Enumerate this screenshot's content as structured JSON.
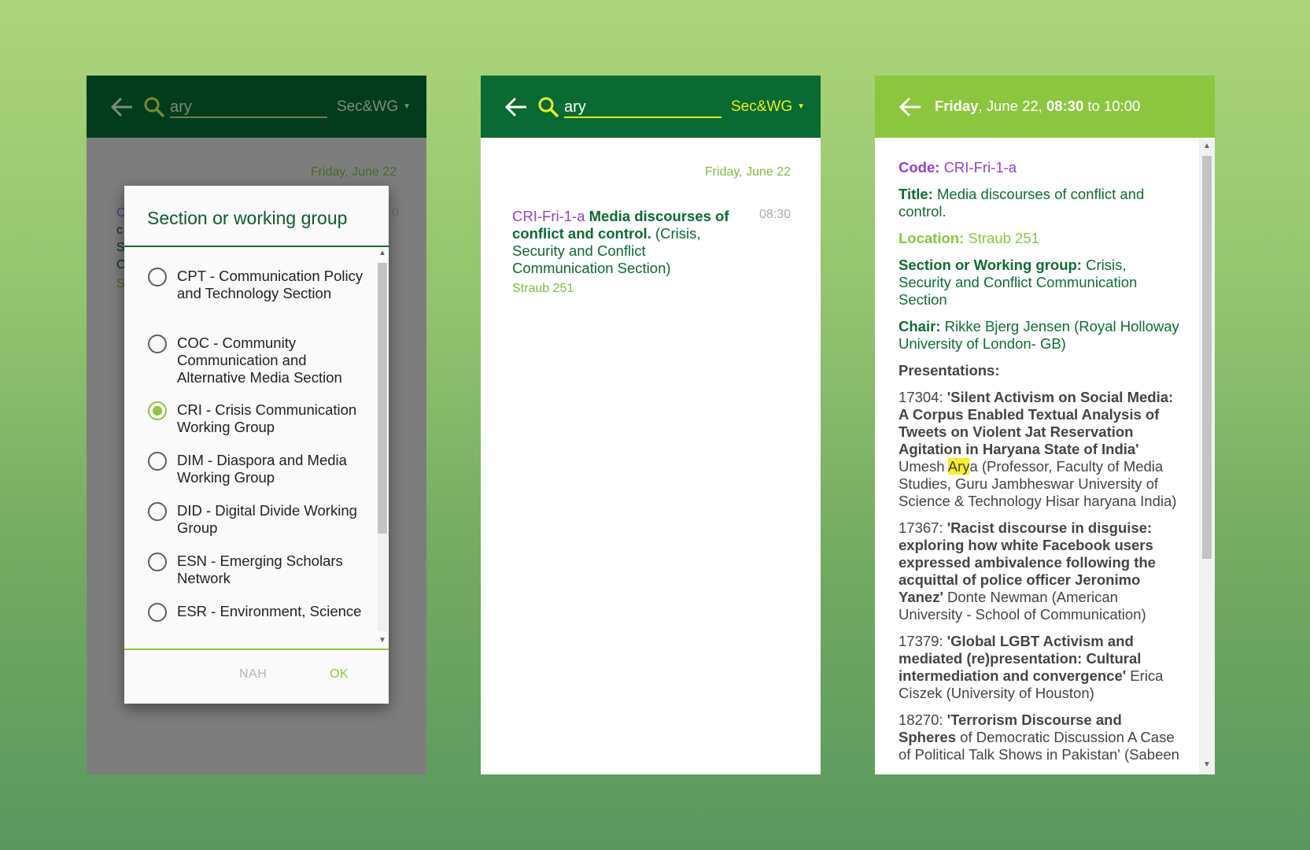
{
  "panel1": {
    "search_query": "ary",
    "filter_label": "Sec&WG",
    "date": "Friday, June 22",
    "dialog": {
      "title": "Section or working group",
      "options": [
        {
          "label": "CPT - Communication Policy and Technology Section",
          "selected": false
        },
        {
          "label": "COC - Community Communication and Alternative Media Section",
          "selected": false
        },
        {
          "label": "CRI - Crisis Communication Working Group",
          "selected": true
        },
        {
          "label": "DIM - Diaspora and Media Working Group",
          "selected": false
        },
        {
          "label": "DID - Digital Divide Working Group",
          "selected": false
        },
        {
          "label": "ESN - Emerging Scholars Network",
          "selected": false
        },
        {
          "label": "ESR - Environment, Science",
          "selected": false
        }
      ],
      "cancel_label": "NAH",
      "ok_label": "OK"
    }
  },
  "panel2": {
    "search_query": "ary",
    "filter_label": "Sec&WG",
    "date": "Friday, June 22",
    "session": {
      "code": "CRI-Fri-1-a",
      "title": "Media discourses of conflict and control.",
      "section": "(Crisis, Security and Conflict Communication Section)",
      "time": "08:30",
      "location": "Straub 251"
    }
  },
  "panel3": {
    "header": {
      "day": "Friday",
      "date": ", June 22, ",
      "start": "08:30",
      "sep": " to ",
      "end": "10:00"
    },
    "code_label": "Code:",
    "code": "CRI-Fri-1-a",
    "title_label": "Title:",
    "title": "Media discourses of conflict and control.",
    "location_label": "Location:",
    "location": "Straub 251",
    "section_label": "Section or Working group:",
    "section": "Crisis, Security and Conflict Communication Section",
    "chair_label": "Chair:",
    "chair": "Rikke Bjerg Jensen (Royal Holloway University of London- GB)",
    "presentations_label": "Presentations:",
    "presentations": [
      {
        "id": "17304: ",
        "title": "'Silent Activism on Social Media: A Corpus Enabled Textual Analysis of Tweets on Violent Jat Reservation Agitation in Haryana State of India'",
        "author_pre": "Umesh ",
        "author_hl": "Ary",
        "author_post": "a (Professor, Faculty of Media Studies, Guru Jambheswar University of Science & Technology Hisar haryana India)"
      },
      {
        "id": "17367: ",
        "title": "'Racist discourse in disguise: exploring how white Facebook users expressed ambivalence following the acquittal of police officer Jeronimo Yanez'",
        "authors": " Donte Newman (American University - School of Communication)"
      },
      {
        "id": "17379: ",
        "title": "'Global LGBT Activism and mediated (re)presentation: Cultural intermediation and convergence'",
        "authors": " Erica Ciszek (University of Houston)"
      },
      {
        "id": "18270: ",
        "title": "'Terrorism Discourse and Spheres",
        "authors": " of Democratic Discussion A Case of Political Talk Shows in Pakistan' (Sabeen"
      }
    ]
  },
  "colors": {
    "dark_green": "#033c1d",
    "green": "#0a6a33",
    "light_green": "#8cc63f",
    "purple": "#8e41d6",
    "yellow": "#e9ef1a"
  }
}
